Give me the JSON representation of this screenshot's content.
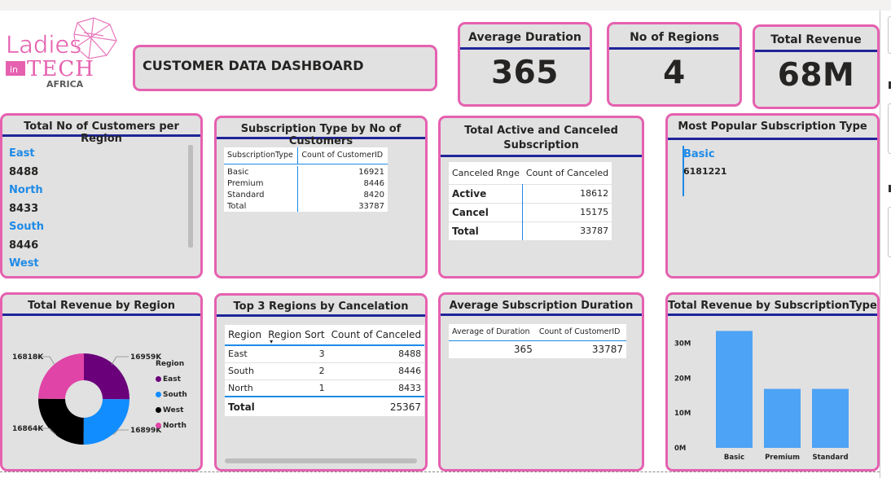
{
  "logo": {
    "line1": "Ladies",
    "in": "in",
    "line2": "TECH",
    "line3": "AFRICA"
  },
  "header": {
    "title": "CUSTOMER DATA DASHBOARD"
  },
  "kpis": [
    {
      "label": "Average Duration",
      "value": "365"
    },
    {
      "label": "No of Regions",
      "value": "4"
    },
    {
      "label": "Total Revenue",
      "value": "68M"
    }
  ],
  "customers_per_region": {
    "title": "Total No of Customers per Region",
    "items": [
      {
        "region": "East",
        "count": "8488"
      },
      {
        "region": "North",
        "count": "8433"
      },
      {
        "region": "South",
        "count": "8446"
      },
      {
        "region": "West",
        "count": ""
      }
    ]
  },
  "subscription_type_table": {
    "title": "Subscription Type by No of Customers",
    "headers": [
      "SubscriptionType",
      "Count of CustomerID"
    ],
    "rows": [
      [
        "Basic",
        "16921"
      ],
      [
        "Premium",
        "8446"
      ],
      [
        "Standard",
        "8420"
      ],
      [
        "Total",
        "33787"
      ]
    ]
  },
  "active_canceled": {
    "title_line1": "Total Active and Canceled",
    "title_line2": "Subscription",
    "headers": [
      "Canceled Rnge",
      "Count of Canceled"
    ],
    "rows": [
      [
        "Active",
        "18612"
      ],
      [
        "Cancel",
        "15175"
      ],
      [
        "Total",
        "33787"
      ]
    ]
  },
  "popular_subscription": {
    "title": "Most Popular Subscription Type",
    "type": "Basic",
    "value": "6181221"
  },
  "revenue_by_region": {
    "title": "Total Revenue by Region",
    "legend_title": "Region",
    "labels": [
      "16818K",
      "16959K",
      "16864K",
      "16899K"
    ],
    "colors": {
      "East": "#6b007b",
      "South": "#118dff",
      "West": "#000000",
      "North": "#e044a7"
    }
  },
  "top3_cancel": {
    "title": "Top 3 Regions by Cancelation",
    "headers": [
      "Region",
      "Region Sort",
      "Count of Canceled"
    ],
    "rows": [
      [
        "East",
        "3",
        "8488"
      ],
      [
        "South",
        "2",
        "8446"
      ],
      [
        "North",
        "1",
        "8433"
      ]
    ],
    "total": [
      "Total",
      "",
      "25367"
    ]
  },
  "avg_duration": {
    "title": "Average Subscription Duration",
    "headers": [
      "Average of Duration",
      "Count of CustomerID"
    ],
    "row": [
      "365",
      "33787"
    ]
  },
  "revenue_by_subscription": {
    "title": "Total Revenue by SubscriptionType"
  },
  "chart_data": [
    {
      "type": "pie",
      "title": "Total Revenue by Region",
      "categories": [
        "East",
        "South",
        "West",
        "North"
      ],
      "values": [
        16959,
        16899,
        16864,
        16818
      ],
      "legend_title": "Region",
      "legend": "right",
      "colors": [
        "#6b007b",
        "#118dff",
        "#000000",
        "#e044a7"
      ]
    },
    {
      "type": "bar",
      "title": "Total Revenue by SubscriptionType",
      "categories": [
        "Basic",
        "Premium",
        "Standard"
      ],
      "values": [
        33.5,
        16.9,
        16.9
      ],
      "ylabel": "",
      "yticks": [
        "0M",
        "10M",
        "20M",
        "30M"
      ],
      "ylim": [
        0,
        35
      ],
      "color": "#4da3f5"
    }
  ]
}
